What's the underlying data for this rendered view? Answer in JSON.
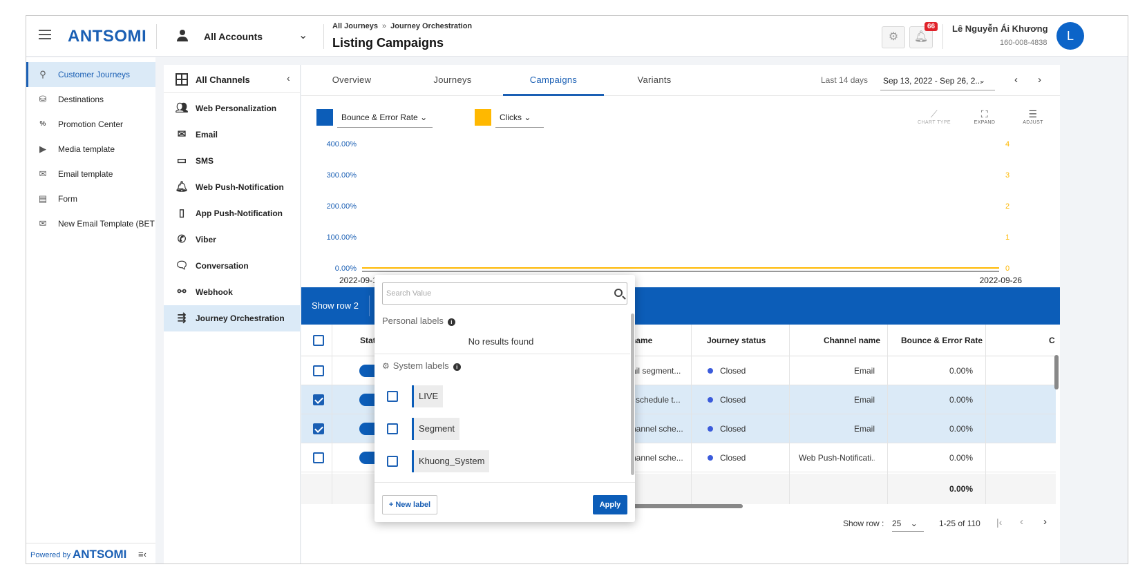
{
  "header": {
    "brand": "ANTSOMI",
    "account_label": "All Accounts",
    "breadcrumb": [
      "All Journeys",
      "Journey Orchestration"
    ],
    "breadcrumb_sep": "»",
    "page_title": "Listing Campaigns",
    "notification_count": "66",
    "user_name": "Lê Nguyễn Ái Khương",
    "user_id": "160-008-4838",
    "avatar_letter": "L"
  },
  "sidebar": {
    "items": [
      {
        "label": "Customer Journeys",
        "icon": "journey-icon",
        "active": true
      },
      {
        "label": "Destinations",
        "icon": "destination-icon",
        "active": false
      },
      {
        "label": "Promotion Center",
        "icon": "promotion-icon",
        "active": false
      },
      {
        "label": "Media template",
        "icon": "media-icon",
        "active": false
      },
      {
        "label": "Email template",
        "icon": "email-icon",
        "active": false
      },
      {
        "label": "Form",
        "icon": "form-icon",
        "active": false
      },
      {
        "label": "New Email Template (BET",
        "icon": "email-icon",
        "active": false
      }
    ],
    "powered_by": "Powered by",
    "powered_brand": "ANTSOMI"
  },
  "channels": {
    "header": "All Channels",
    "items": [
      {
        "label": "Web Personalization",
        "icon": "web-personalization-icon"
      },
      {
        "label": "Email",
        "icon": "email-icon"
      },
      {
        "label": "SMS",
        "icon": "sms-icon"
      },
      {
        "label": "Web Push-Notification",
        "icon": "bell-icon"
      },
      {
        "label": "App Push-Notification",
        "icon": "mobile-icon"
      },
      {
        "label": "Viber",
        "icon": "viber-icon"
      },
      {
        "label": "Conversation",
        "icon": "conversation-icon"
      },
      {
        "label": "Webhook",
        "icon": "webhook-icon"
      },
      {
        "label": "Journey Orchestration",
        "icon": "orchestration-icon",
        "active": true
      }
    ]
  },
  "tabs": [
    "Overview",
    "Journeys",
    "Campaigns",
    "Variants"
  ],
  "active_tab": "Campaigns",
  "date_range": {
    "label": "Last 14 days",
    "value": "Sep 13, 2022 - Sep 26, 2..."
  },
  "chart_toolbar": {
    "metric1": {
      "label": "Bounce & Error Rate",
      "color": "#0c5db8"
    },
    "metric2": {
      "label": "Clicks",
      "color": "#ffb800"
    },
    "tools": [
      "CHART TYPE",
      "EXPAND",
      "ADJUST"
    ]
  },
  "chart_data": {
    "type": "line",
    "x": [
      "2022-09-13",
      "2022-09-26"
    ],
    "series": [
      {
        "name": "Bounce & Error Rate",
        "values": [
          0,
          0
        ],
        "axis": "left",
        "color": "#555555"
      },
      {
        "name": "Clicks",
        "values": [
          0,
          0
        ],
        "axis": "right",
        "color": "#ffb800"
      }
    ],
    "y_left_ticks": [
      "400.00%",
      "300.00%",
      "200.00%",
      "100.00%",
      "0.00%"
    ],
    "y_right_ticks": [
      "4",
      "3",
      "2",
      "1",
      "0"
    ],
    "x_tick_labels": [
      "2022-09-13",
      "2022-09-26"
    ],
    "ylim_left": [
      0,
      4
    ],
    "ylim_right": [
      0,
      4
    ],
    "grid": false
  },
  "table": {
    "show_row_label": "Show row 2",
    "columns": {
      "status": "Stat",
      "name": "name",
      "journey_status": "Journey status",
      "channel": "Channel name",
      "bounce": "Bounce & Error Rate",
      "extra": "C"
    },
    "rows": [
      {
        "name": "ail segment...",
        "status": "Closed",
        "channel": "Email",
        "bounce": "0.00%",
        "selected": false
      },
      {
        "name": "l schedule t...",
        "status": "Closed",
        "channel": "Email",
        "bounce": "0.00%",
        "selected": true
      },
      {
        "name": "hannel sche...",
        "status": "Closed",
        "channel": "Email",
        "bounce": "0.00%",
        "selected": true
      },
      {
        "name": "hannel sche...",
        "status": "Closed",
        "channel": "Web Push-Notificati...",
        "bounce": "0.00%",
        "selected": false
      }
    ],
    "footer_bounce": "0.00%"
  },
  "pagination": {
    "label": "Show row :",
    "rows_per_page": "25",
    "range": "1-25 of 110"
  },
  "label_popover": {
    "search_placeholder": "Search Value",
    "personal_labels": "Personal labels",
    "no_results": "No results found",
    "system_labels": "System labels",
    "labels": [
      "LIVE",
      "Segment",
      "Khuong_System"
    ],
    "new_label_button": "+ New label",
    "apply_button": "Apply"
  }
}
